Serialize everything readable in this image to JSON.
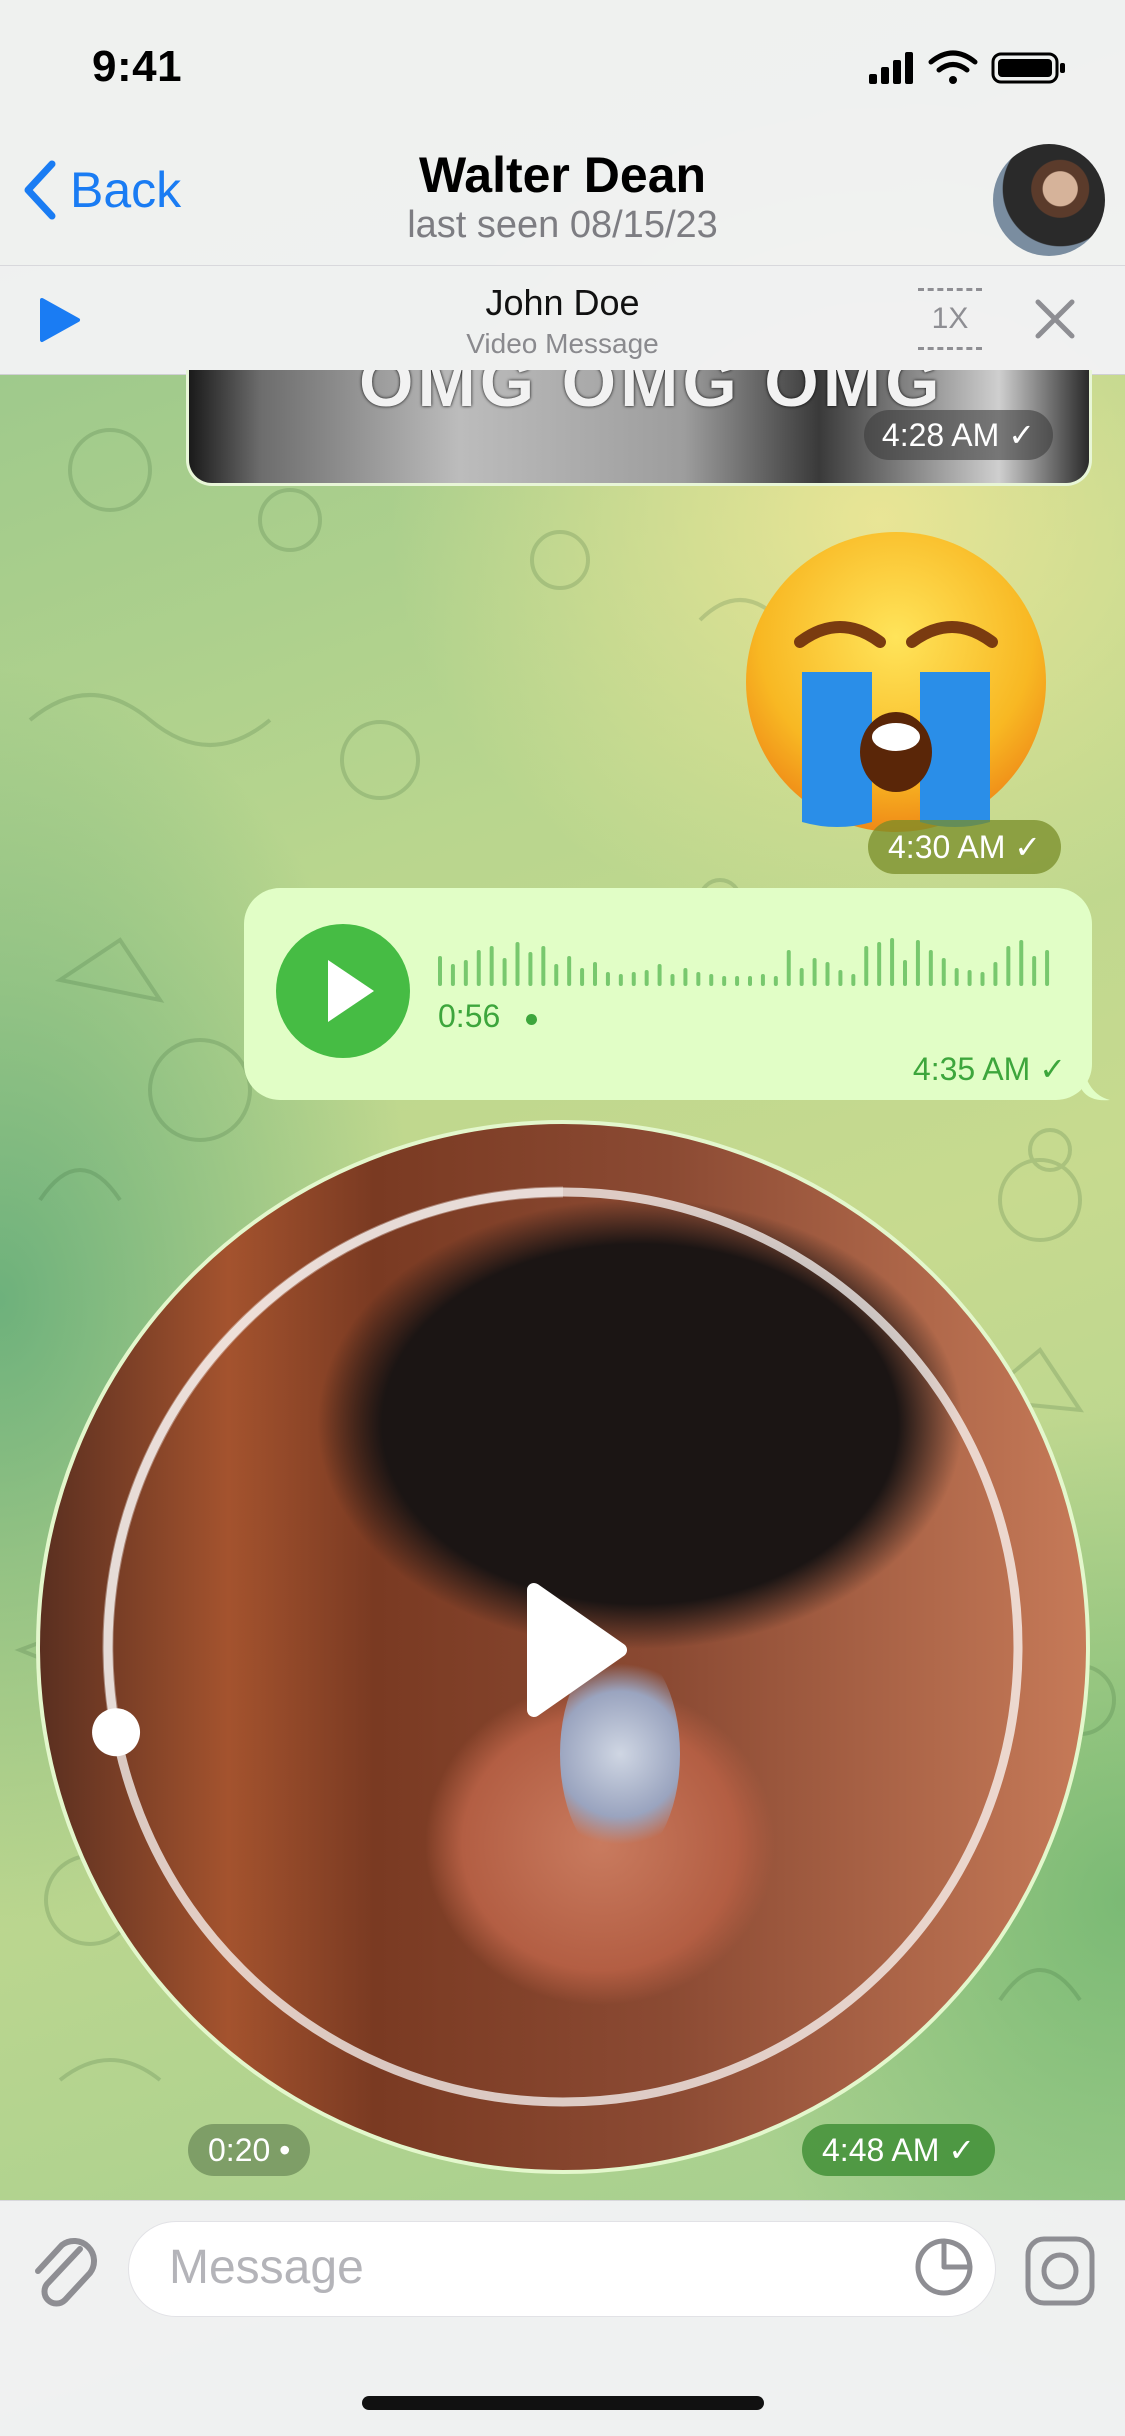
{
  "status": {
    "time": "9:41"
  },
  "header": {
    "back_label": "Back",
    "title": "Walter Dean",
    "subtitle": "last seen 08/15/23"
  },
  "player": {
    "name": "John Doe",
    "subtitle": "Video Message",
    "speed": "1X"
  },
  "messages": {
    "image": {
      "caption": "OMG OMG OMG",
      "time": "4:28 AM"
    },
    "emoji": {
      "time": "4:30 AM"
    },
    "voice": {
      "duration": "0:56",
      "time": "4:35 AM"
    },
    "video": {
      "duration": "0:20",
      "time": "4:48 AM",
      "progress": 0.28
    }
  },
  "composer": {
    "placeholder": "Message"
  },
  "colors": {
    "accent": "#1a7cf3",
    "voice_green": "#46bc44",
    "outgoing_bubble": "#e1fec6"
  }
}
